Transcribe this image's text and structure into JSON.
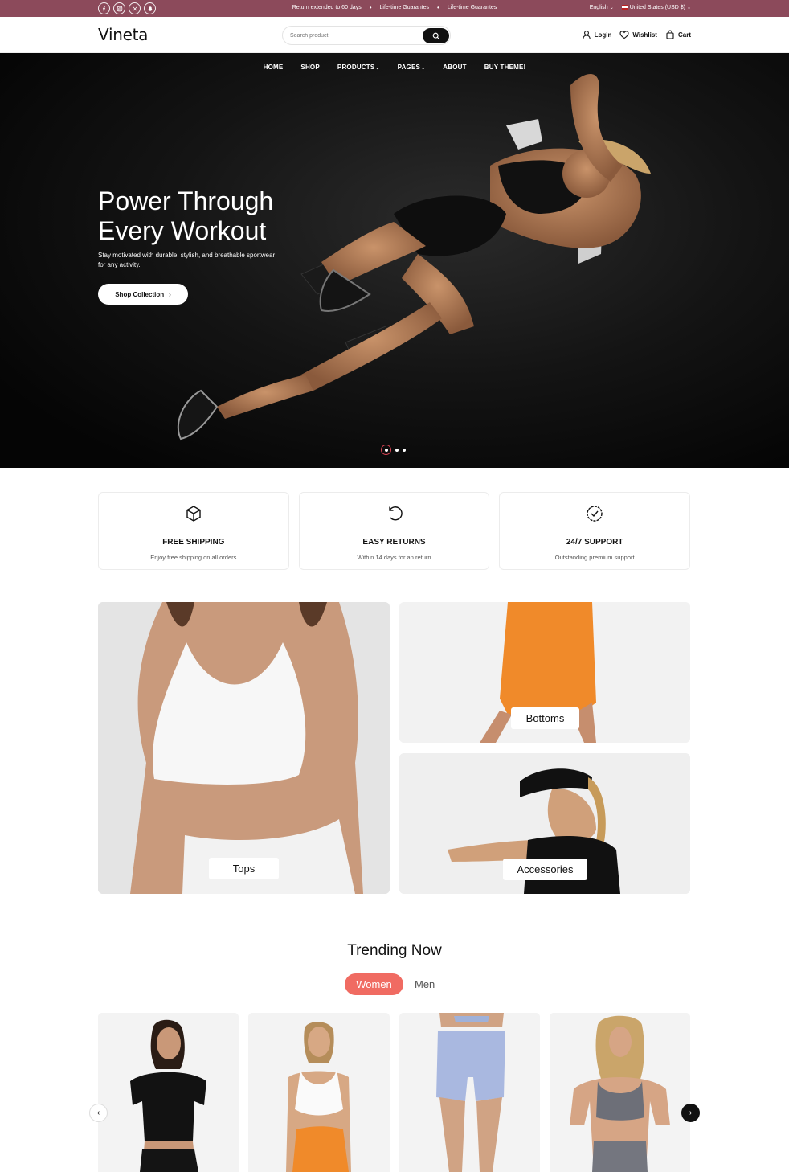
{
  "topbar": {
    "social": [
      "facebook-icon",
      "instagram-icon",
      "x-icon",
      "snapchat-icon"
    ],
    "announcements": [
      "Return extended to 60 days",
      "Life-time Guarantes",
      "Life-time Guarantes"
    ],
    "language": "English",
    "currency": "United States (USD $)",
    "bg_color": "#8c4a5b"
  },
  "header": {
    "logo": "Vineta",
    "search_placeholder": "Search product",
    "login": "Login",
    "wishlist": "Wishlist",
    "cart": "Cart"
  },
  "nav": {
    "items": [
      {
        "label": "HOME",
        "dropdown": false
      },
      {
        "label": "SHOP",
        "dropdown": false
      },
      {
        "label": "PRODUCTS",
        "dropdown": true
      },
      {
        "label": "PAGES",
        "dropdown": true
      },
      {
        "label": "ABOUT",
        "dropdown": false
      },
      {
        "label": "BUY THEME!",
        "dropdown": false
      }
    ]
  },
  "hero": {
    "title_line1": "Power Through",
    "title_line2": "Every Workout",
    "subtitle": "Stay motivated with durable, stylish, and breathable sportwear for any activity.",
    "cta": "Shop Collection",
    "slides": 3,
    "active_slide": 1
  },
  "features": [
    {
      "icon": "box-icon",
      "title": "FREE SHIPPING",
      "desc": "Enjoy free shipping on all orders"
    },
    {
      "icon": "return-icon",
      "title": "EASY RETURNS",
      "desc": "Within 14 days for an return"
    },
    {
      "icon": "check-badge-icon",
      "title": "24/7 SUPPORT",
      "desc": "Outstanding premium support"
    }
  ],
  "categories": {
    "tops": "Tops",
    "bottoms": "Bottoms",
    "accessories": "Accessories"
  },
  "trending": {
    "title": "Trending Now",
    "tabs": [
      {
        "label": "Women",
        "active": true
      },
      {
        "label": "Men",
        "active": false
      }
    ],
    "accent": "#f06b62"
  }
}
